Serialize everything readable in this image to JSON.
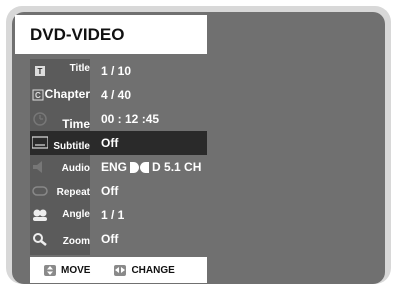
{
  "header": {
    "title": "DVD-VIDEO"
  },
  "menu": {
    "items": [
      {
        "label": "Title",
        "value": "1 / 10",
        "icon": "title-icon"
      },
      {
        "label": "Chapter",
        "value": "4 / 40",
        "icon": "chapter-icon"
      },
      {
        "label": "Time",
        "value": "00 : 12 :45",
        "icon": "clock-icon"
      },
      {
        "label": "Subtitle",
        "value": "Off",
        "icon": "subtitle-icon",
        "selected": true
      },
      {
        "label": "Audio",
        "value": "ENG",
        "audio_format": "D 5.1 CH",
        "icon": "speaker-icon"
      },
      {
        "label": "Repeat",
        "value": "Off",
        "icon": "repeat-icon"
      },
      {
        "label": "Angle",
        "value": "1 / 1",
        "icon": "angle-icon"
      },
      {
        "label": "Zoom",
        "value": "Off",
        "icon": "zoom-icon"
      }
    ]
  },
  "footer": {
    "move_label": "MOVE",
    "change_label": "CHANGE"
  },
  "colors": {
    "frame": "#d8d8d8",
    "screen": "#707070",
    "icon_column": "#5b5b5b",
    "selected_row": "#2a2a2a"
  }
}
